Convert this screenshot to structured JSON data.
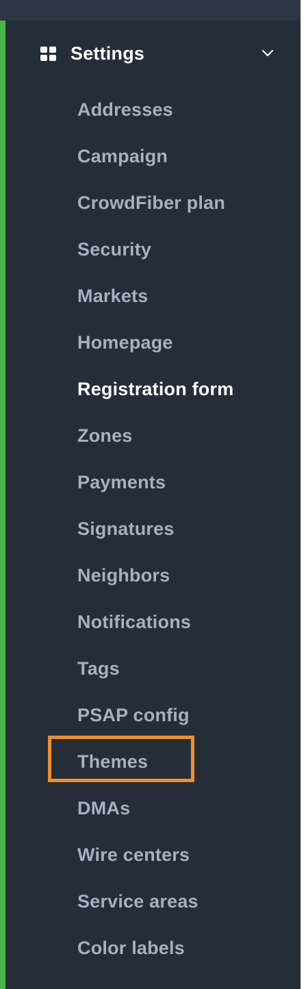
{
  "colors": {
    "sidebar_bg": "#252d39",
    "topbar_bg": "#2d3643",
    "active_stripe": "#4ab548",
    "item_text": "#a7b0bf",
    "active_text": "#ffffff",
    "highlight": "#f28f25"
  },
  "section": {
    "icon": "grid-icon",
    "title": "Settings",
    "expand_icon": "chevron-down-icon"
  },
  "menu": {
    "items": [
      {
        "label": "Addresses",
        "active": false
      },
      {
        "label": "Campaign",
        "active": false
      },
      {
        "label": "CrowdFiber plan",
        "active": false
      },
      {
        "label": "Security",
        "active": false
      },
      {
        "label": "Markets",
        "active": false
      },
      {
        "label": "Homepage",
        "active": false
      },
      {
        "label": "Registration form",
        "active": true
      },
      {
        "label": "Zones",
        "active": false
      },
      {
        "label": "Payments",
        "active": false
      },
      {
        "label": "Signatures",
        "active": false
      },
      {
        "label": "Neighbors",
        "active": false
      },
      {
        "label": "Notifications",
        "active": false
      },
      {
        "label": "Tags",
        "active": false
      },
      {
        "label": "PSAP config",
        "active": false
      },
      {
        "label": "Themes",
        "active": false,
        "highlighted": true
      },
      {
        "label": "DMAs",
        "active": false
      },
      {
        "label": "Wire centers",
        "active": false
      },
      {
        "label": "Service areas",
        "active": false
      },
      {
        "label": "Color labels",
        "active": false
      }
    ]
  }
}
